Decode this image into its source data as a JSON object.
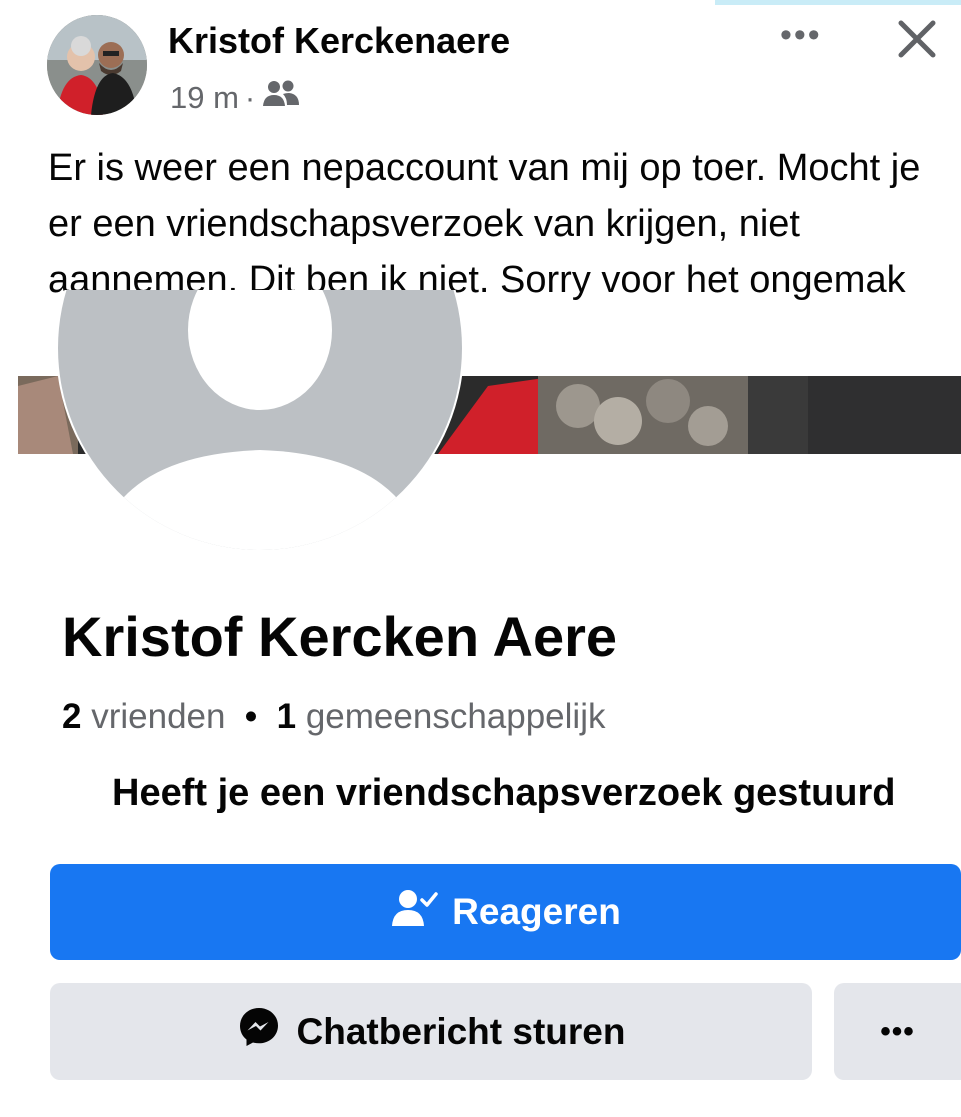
{
  "post": {
    "author": "Kristof Kerckenaere",
    "time": "19 m",
    "separator": "·",
    "audience_icon": "friends-icon",
    "more_icon": "•••",
    "close_icon": "close-icon",
    "text": "Er is weer een nepaccount van mij op toer. Mocht je er een vriendschapsverzoek van krijgen, niet aannemen. Dit ben ik niet. Sorry voor het ongemak"
  },
  "profile": {
    "name": "Kristof Kercken Aere",
    "friends_count": "2",
    "friends_label": "vrienden",
    "dot": "•",
    "mutual_count": "1",
    "mutual_label": "gemeenschappelijk",
    "request_text": "Heeft je een vriendschapsverzoek gestuurd",
    "respond_label": "Reageren",
    "message_label": "Chatbericht sturen",
    "more_label": "•••"
  },
  "colors": {
    "accent": "#1877f2",
    "secondary_button": "#e4e6eb",
    "muted_text": "#65676b"
  }
}
